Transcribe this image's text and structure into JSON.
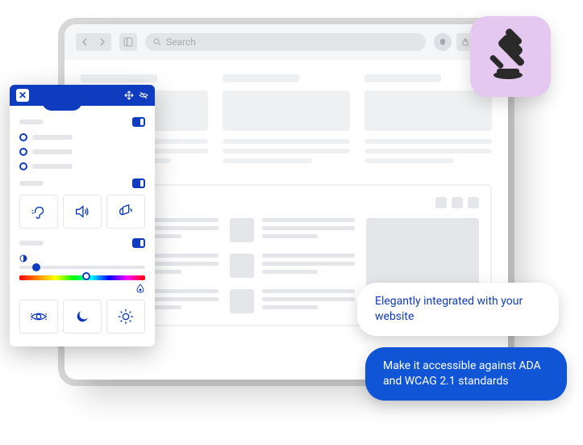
{
  "browser": {
    "search_placeholder": "Search"
  },
  "widget": {
    "icons_row1": [
      "ear",
      "speaker",
      "microphone"
    ],
    "icons_row2": [
      "eye",
      "moon",
      "sun"
    ]
  },
  "bubbles": {
    "white": "Elegantly integrated with your website",
    "blue": "Make it accessible against ADA and WCAG 2.1 standards"
  },
  "badge": {
    "icon": "gavel"
  }
}
